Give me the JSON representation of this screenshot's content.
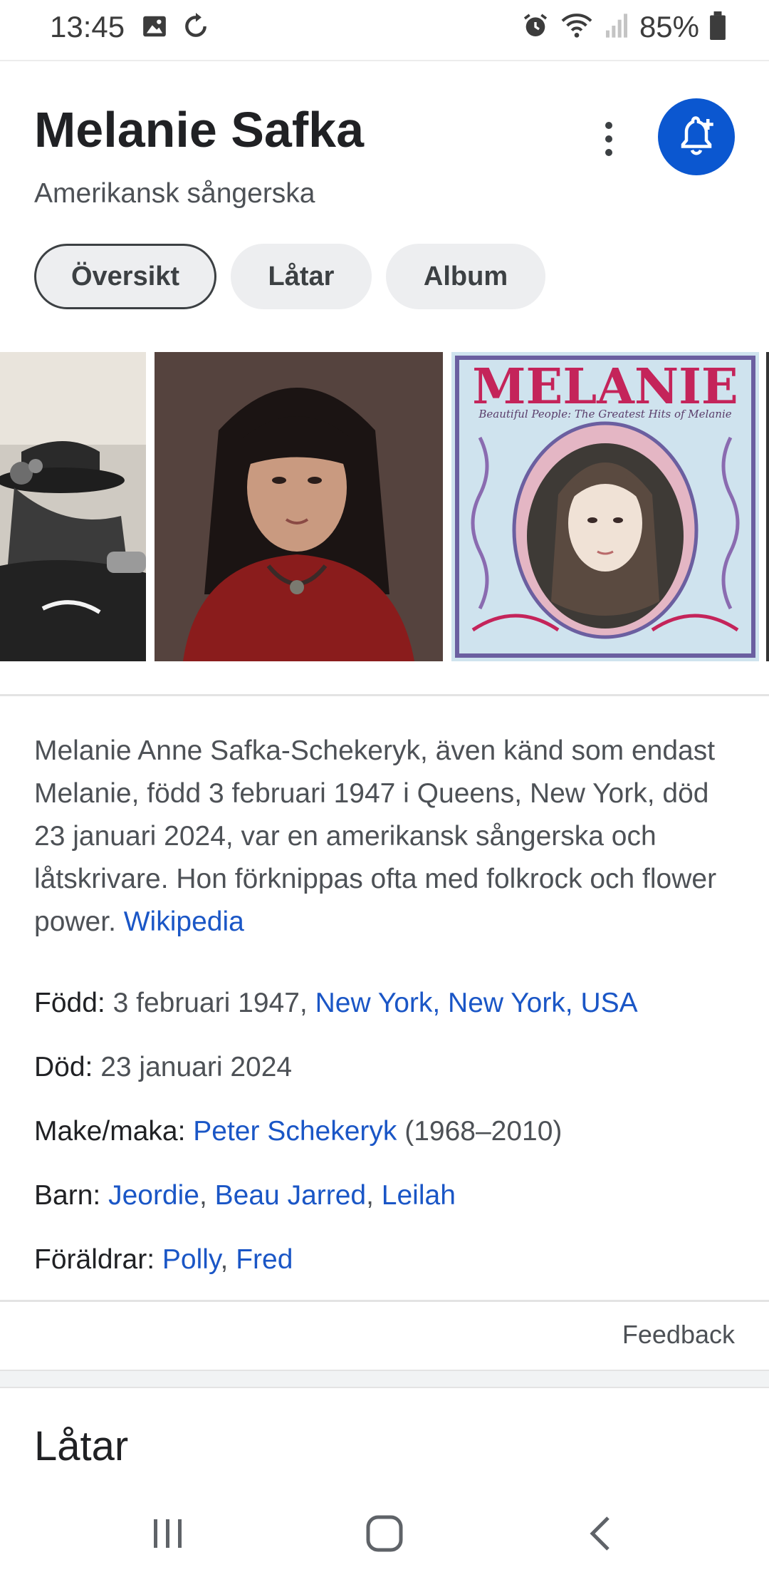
{
  "status_bar": {
    "time": "13:45",
    "battery": "85%",
    "icons": [
      "image-icon",
      "sync-icon",
      "alarm-icon",
      "wifi-icon",
      "signal-icon",
      "battery-icon"
    ]
  },
  "entity": {
    "name": "Melanie Safka",
    "subtitle": "Amerikansk sångerska"
  },
  "tabs": [
    {
      "label": "Översikt",
      "active": true
    },
    {
      "label": "Låtar",
      "active": false
    },
    {
      "label": "Album",
      "active": false
    }
  ],
  "gallery": {
    "album_cover_title": "MELANIE",
    "album_cover_subtitle": "Beautiful People: The Greatest Hits of Melanie"
  },
  "description": {
    "text": "Melanie Anne Safka-Schekeryk, även känd som endast Melanie, född 3 februari 1947 i Queens, New York, död 23 januari 2024, var en amerikansk sångerska och låtskrivare. Hon förknippas ofta med folkrock och flower power.",
    "source_link": "Wikipedia"
  },
  "facts": {
    "born": {
      "label": "Född:",
      "value": "3 februari 1947,",
      "link": "New York, New York, USA"
    },
    "died": {
      "label": "Död:",
      "value": "23 januari 2024"
    },
    "spouse": {
      "label": "Make/maka:",
      "link": "Peter Schekeryk",
      "value": "(1968–2010)"
    },
    "children": {
      "label": "Barn:",
      "links": [
        "Jeordie",
        "Beau Jarred",
        "Leilah"
      ]
    },
    "parents": {
      "label": "Föräldrar:",
      "links": [
        "Polly",
        "Fred"
      ]
    }
  },
  "feedback_label": "Feedback",
  "songs_heading": "Låtar",
  "colors": {
    "accent": "#0b57d0",
    "link": "#1a56c6"
  }
}
